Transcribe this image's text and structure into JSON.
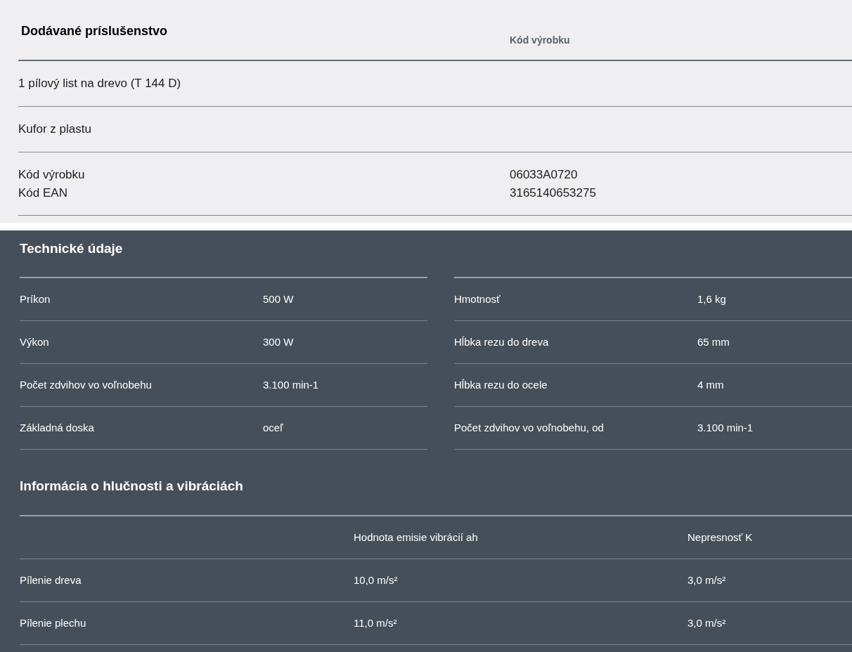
{
  "accessories": {
    "title": "Dodávané príslušenstvo",
    "column_header": "Kód výrobku",
    "rows": [
      {
        "kind": "item",
        "label": "1 pílový list na drevo (T 144 D)"
      },
      {
        "kind": "item",
        "label": "Kufor z plastu"
      },
      {
        "kind": "codes",
        "lines": [
          {
            "label": "Kód výrobku",
            "value": "06033A0720"
          },
          {
            "label": "Kód EAN",
            "value": "3165140653275"
          }
        ]
      }
    ]
  },
  "technical_data": {
    "title": "Technické údaje",
    "columns": [
      [
        {
          "label": "Príkon",
          "value": "500 W"
        },
        {
          "label": "Výkon",
          "value": "300 W"
        },
        {
          "label": "Počet zdvihov vo voľnobehu",
          "value": "3.100 min-1"
        },
        {
          "label": "Základná doska",
          "value": "oceľ"
        }
      ],
      [
        {
          "label": "Hmotnosť",
          "value": "1,6 kg"
        },
        {
          "label": "Hĺbka rezu do dreva",
          "value": "65 mm"
        },
        {
          "label": "Hĺbka rezu do ocele",
          "value": "4 mm"
        },
        {
          "label": "Počet zdvihov vo voľnobehu, od",
          "value": "3.100 min-1"
        }
      ]
    ]
  },
  "noise_vibration": {
    "title": "Informácia o hlučnosti a vibráciách",
    "columns": [
      "Hodnota emisie vibrácií ah",
      "Nepresnosť K"
    ],
    "rows": [
      {
        "label": "Pílenie dreva",
        "values": [
          "10,0 m/s²",
          "3,0 m/s²"
        ]
      },
      {
        "label": "Pílenie plechu",
        "values": [
          "11,0 m/s²",
          "3,0 m/s²"
        ]
      }
    ]
  }
}
